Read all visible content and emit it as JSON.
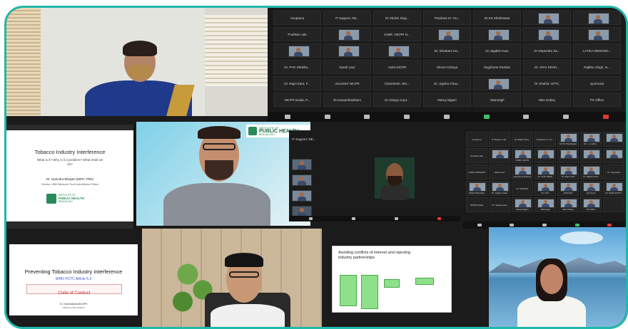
{
  "participants_grid": {
    "names": [
      "Anupama",
      "IT Support, NE...",
      "Dr Shalini Sing...",
      "Prashant Kr. Gu...",
      "Dr.KS Shekhawat",
      "",
      "",
      "Pushkar Lala",
      "",
      "ICMR- NICPR N...",
      "",
      "",
      "",
      "",
      "",
      "",
      "",
      "Dr. Shrabani Ha...",
      "Dr Jagdish Kaur",
      "Dr Nripendra Sa...",
      "LATIKA DEMAND...",
      "Dr. PVK Shekha...",
      "Sarah Laur",
      "Anita NICPR",
      "Shruti Acharya",
      "Sugnhone Roshan",
      "Dr. SHIV KESH...",
      "Rajbhu Singh, N...",
      "Dr. Rajni Kant, F...",
      "ANJUSHI NICPR",
      "Chandresh, NIC...",
      "Dr. Jigisha Chau...",
      "",
      "Dr Shahid, WTTL",
      "Jyoti Kant",
      "NICPR Noida, P...",
      "dr.mvasanthasibam",
      "Dr Sanjay Gupt...",
      "Manoj Nigam",
      "JSameigh",
      "Nitin Dubey",
      "PS Office"
    ]
  },
  "slide_tobacco": {
    "title": "Tobacco Industry Interference",
    "subtitle": "What is it? Why is it a problem? What shall we do?",
    "speaker": "Dr. Upendra Bhojani (MPH, PhD)",
    "affiliation": "Director, UBM Wellcome Trust India Alliance Fellow",
    "logo_line1": "INSTITUTE OF",
    "logo_line2": "PUBLIC HEALTH",
    "logo_line3": "BENGALURU"
  },
  "banner_phb": {
    "line1": "INSTITUTE OF",
    "line2": "PUBLIC HEALTH",
    "line3": "BENGALURU"
  },
  "slide_preventing": {
    "title": "Preventing Tobacco Industry Interference",
    "subtitle": "WHO FCTC Article 5.3",
    "box": "Code of Conduct",
    "footer1": "Dr. Chandrakanta MD MPH",
    "footer2": "INDIA ILLITEC SCHPH"
  },
  "slide_conflicts": {
    "title": "Avoiding conflicts of interest and rejecting industry partnerships"
  },
  "small_grid_names": [
    "Anupama",
    "IT Support, NE...",
    "Dr Shalini Sing...",
    "Prashant Kr. Gu...",
    "Dr.KS Shekhawat",
    "Dr L. Londhe...",
    "",
    "Pushkar Lala",
    "",
    "ICMR- NICPR",
    "",
    "",
    "",
    "",
    "LATIKA DEMAND",
    "Sarah Laur",
    "Sugnhone Roshan",
    "Dr. SHIV KESH",
    "Dr. Rajni Kant",
    "Dr Jagdish Kaur",
    "Dr. Nripendra",
    "Shashi Bhushan",
    "Dr. Jigisha Chau",
    "Dr. Shrabani",
    "Dr. PVK",
    "ANJUSHI",
    "Jyoti Kant",
    "Dr. Shahid WTTL",
    "NICPR Noida",
    "Dr. Sanjay Gupt",
    "Manoj Nigam",
    "JSameigh",
    "Nitin Dubey",
    "PS Office",
    ""
  ],
  "small_list_names": [
    "IT Support, NE...",
    "",
    "",
    ""
  ],
  "toolbar_labels": [
    "Mute",
    "Stop Video",
    "Security",
    "Participants",
    "Chat",
    "Share Screen",
    "Record",
    "Reactions",
    "Leave"
  ],
  "colors": {
    "frame": "#20b8a8",
    "zoom_bg": "#1b1b1b",
    "green_box": "#8fe08a",
    "leave_red": "#e03a2f",
    "banner_green": "#2b8a5a"
  }
}
